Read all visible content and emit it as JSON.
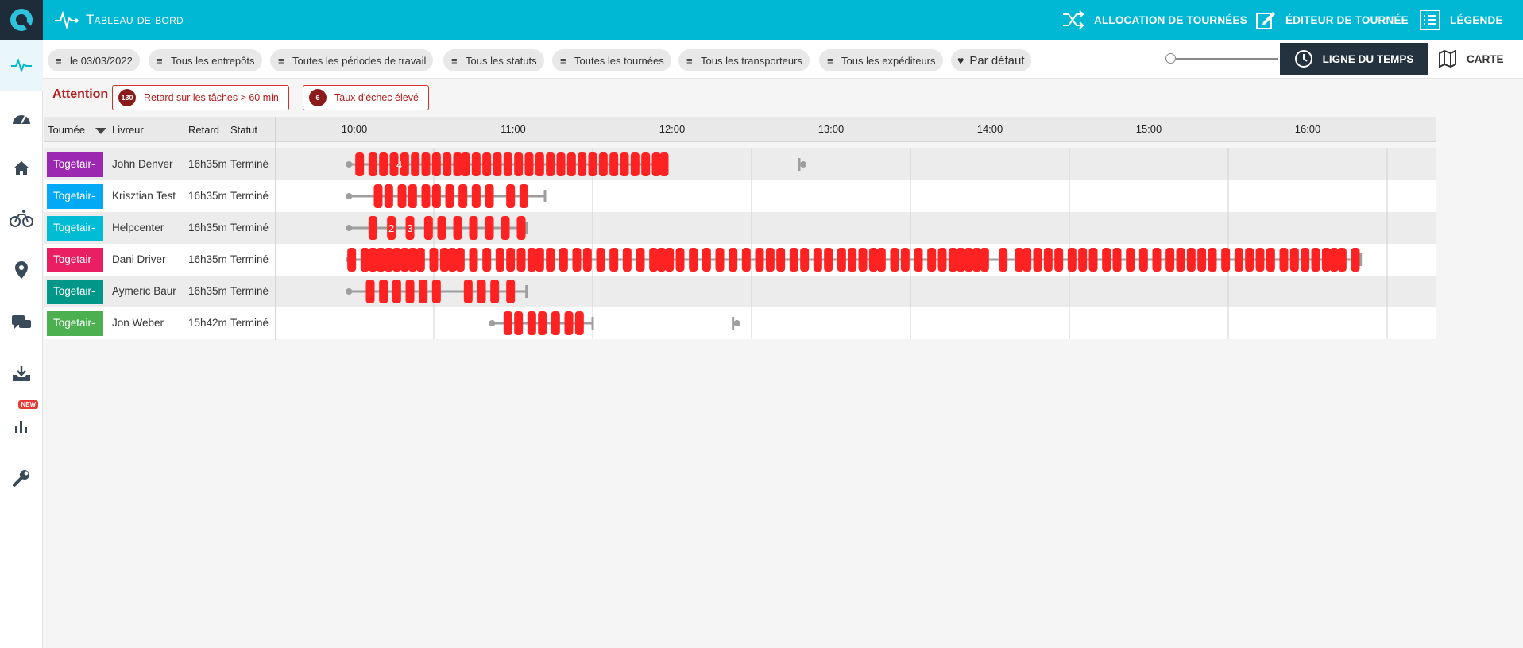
{
  "app": {
    "title": "Tableau de bord"
  },
  "topbar": {
    "allocation_label": "ALLOCATION DE TOURNÉES",
    "editor_label": "ÉDITEUR DE TOURNÉE",
    "legend_label": "LÉGENDE"
  },
  "sidebar": {
    "items": [
      {
        "name": "pulse-icon",
        "active": true
      },
      {
        "name": "speedometer-icon"
      },
      {
        "name": "home-icon"
      },
      {
        "name": "bicycle-icon"
      },
      {
        "name": "location-pin-icon"
      },
      {
        "name": "chat-icon"
      },
      {
        "name": "download-tray-icon"
      },
      {
        "name": "bar-chart-icon",
        "badge": "NEW"
      },
      {
        "name": "wrench-icon"
      }
    ]
  },
  "filters": [
    "le 03/03/2022",
    "Tous les entrepôts",
    "Toutes les périodes de travail",
    "Tous les statuts",
    "Toutes les tournées",
    "Tous les transporteurs",
    "Tous les expéditeurs"
  ],
  "favorite_label": "Par défaut",
  "view": {
    "timeline_label": "LIGNE DU TEMPS",
    "map_label": "CARTE"
  },
  "attention": {
    "label": "Attention",
    "alerts": [
      {
        "count": "130",
        "text": "Retard sur les tâches > 60 min"
      },
      {
        "count": "6",
        "text": "Taux d'échec élevé"
      }
    ]
  },
  "table": {
    "headers": {
      "tour": "Tournée",
      "driver": "Livreur",
      "delay": "Retard",
      "status": "Statut"
    },
    "ticks": [
      "10:00",
      "11:00",
      "12:00",
      "13:00",
      "14:00",
      "15:00",
      "16:00"
    ],
    "rows": [
      {
        "tour": "Togetair-",
        "color": "#9c27b0",
        "driver": "John Denver",
        "delay": "16h35m",
        "status": "Terminé",
        "start": "09:58",
        "end": "11:58",
        "extra_end": "12:48",
        "labels": [
          {
            "text": "4",
            "at": "10:17"
          }
        ],
        "stops": [
          "10:02",
          "10:07",
          "10:11",
          "10:15",
          "10:19",
          "10:23",
          "10:27",
          "10:31",
          "10:35",
          "10:39",
          "10:42",
          "10:46",
          "10:50",
          "10:54",
          "10:58",
          "11:02",
          "11:06",
          "11:10",
          "11:14",
          "11:18",
          "11:22",
          "11:26",
          "11:30",
          "11:34",
          "11:38",
          "11:42",
          "11:46",
          "11:50",
          "11:54",
          "11:57"
        ]
      },
      {
        "tour": "Togetair-",
        "color": "#03a9f4",
        "driver": "Krisztian Test",
        "delay": "16h35m",
        "status": "Terminé",
        "start": "09:58",
        "end": "11:12",
        "labels": [],
        "stops": [
          "10:09",
          "10:13",
          "10:18",
          "10:22",
          "10:27",
          "10:31",
          "10:36",
          "10:41",
          "10:46",
          "10:51",
          "10:59",
          "11:04"
        ]
      },
      {
        "tour": "Togetair-",
        "color": "#00bcd4",
        "driver": "Helpcenter",
        "delay": "16h35m",
        "status": "Terminé",
        "start": "09:58",
        "end": "11:05",
        "labels": [
          {
            "text": "2",
            "at": "10:14"
          },
          {
            "text": "3",
            "at": "10:21"
          }
        ],
        "stops": [
          "10:07",
          "10:14",
          "10:21",
          "10:28",
          "10:33",
          "10:39",
          "10:45",
          "10:51",
          "10:57",
          "11:03"
        ]
      },
      {
        "tour": "Togetair-",
        "color": "#e91e63",
        "driver": "Dani Driver",
        "delay": "16h35m",
        "status": "Terminé",
        "start": "09:58",
        "end": "16:20",
        "labels": [],
        "stops": [
          "09:59",
          "10:04",
          "10:07",
          "10:10",
          "10:13",
          "10:16",
          "10:19",
          "10:22",
          "10:25",
          "10:30",
          "10:34",
          "10:37",
          "10:40",
          "10:45",
          "10:50",
          "10:55",
          "10:59",
          "11:03",
          "11:07",
          "11:10",
          "11:14",
          "11:19",
          "11:24",
          "11:28",
          "11:33",
          "11:38",
          "11:43",
          "11:48",
          "11:53",
          "11:56",
          "11:59",
          "12:03",
          "12:08",
          "12:13",
          "12:18",
          "12:23",
          "12:28",
          "12:33",
          "12:37",
          "12:41",
          "12:46",
          "12:50",
          "12:55",
          "12:59",
          "13:04",
          "13:08",
          "13:12",
          "13:16",
          "13:19",
          "13:24",
          "13:28",
          "13:33",
          "13:38",
          "13:42",
          "13:46",
          "13:49",
          "13:52",
          "13:55",
          "13:58",
          "14:05",
          "14:11",
          "14:14",
          "14:18",
          "14:22",
          "14:26",
          "14:31",
          "14:35",
          "14:39",
          "14:44",
          "14:48",
          "14:53",
          "14:58",
          "15:03",
          "15:08",
          "15:12",
          "15:16",
          "15:20",
          "15:24",
          "15:29",
          "15:34",
          "15:38",
          "15:42",
          "15:46",
          "15:51",
          "15:55",
          "15:59",
          "16:03",
          "16:07",
          "16:10",
          "16:13",
          "16:18"
        ]
      },
      {
        "tour": "Togetair-",
        "color": "#009688",
        "driver": "Aymeric Baur",
        "delay": "16h35m",
        "status": "Terminé",
        "start": "09:58",
        "end": "11:05",
        "labels": [],
        "stops": [
          "10:06",
          "10:11",
          "10:16",
          "10:21",
          "10:26",
          "10:31",
          "10:43",
          "10:48",
          "10:53",
          "10:59"
        ]
      },
      {
        "tour": "Togetair-",
        "color": "#4caf50",
        "driver": "Jon Weber",
        "delay": "15h42m",
        "status": "Terminé",
        "start": "10:52",
        "end": "11:30",
        "extra_end": "12:23",
        "labels": [],
        "stops": [
          "10:58",
          "11:02",
          "11:07",
          "11:11",
          "11:16",
          "11:21",
          "11:25"
        ]
      }
    ]
  }
}
